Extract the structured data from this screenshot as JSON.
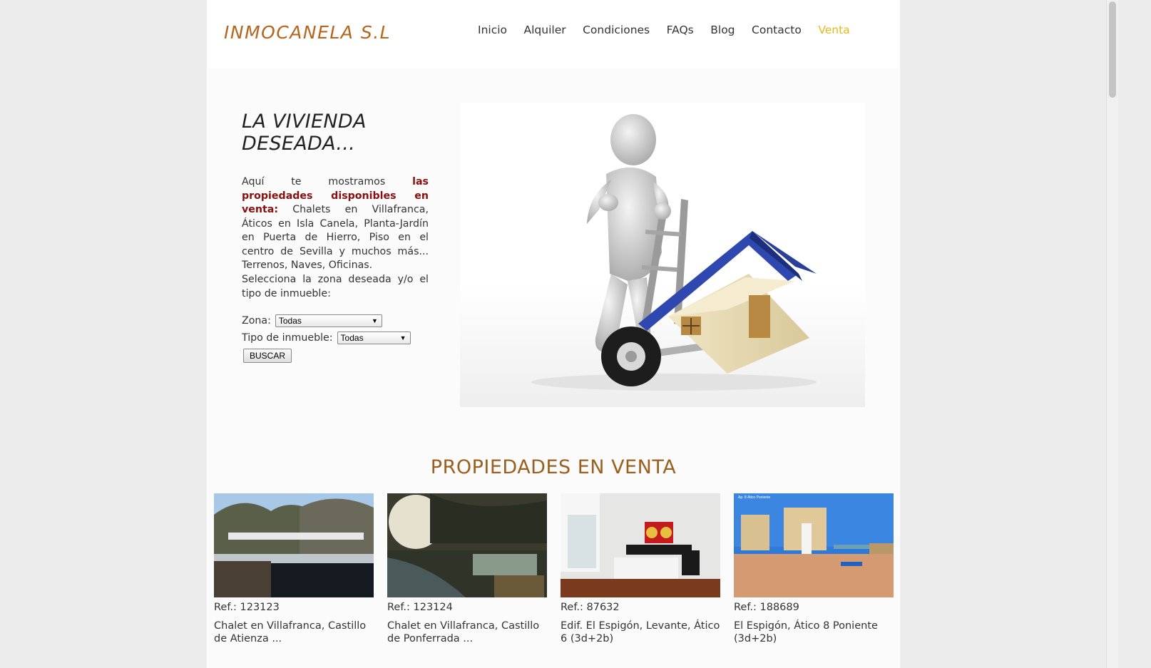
{
  "header": {
    "logo_text": "INMOCANELA S.L",
    "nav": [
      {
        "label": "Inicio",
        "active": false
      },
      {
        "label": "Alquiler",
        "active": false
      },
      {
        "label": "Condiciones",
        "active": false
      },
      {
        "label": "FAQs",
        "active": false
      },
      {
        "label": "Blog",
        "active": false
      },
      {
        "label": "Contacto",
        "active": false
      },
      {
        "label": "Venta",
        "active": true
      }
    ]
  },
  "hero": {
    "title_line1": "LA VIVIENDA",
    "title_line2": "DESEADA...",
    "intro_prefix": "Aquí te mostramos ",
    "intro_highlight": "las propiedades disponibles en venta:",
    "intro_rest": " Chalets en Villafranca, Áticos en Isla Canela, Planta-Jardín en Puerta de Hierro, Piso en el centro de Sevilla y muchos más... Terrenos, Naves, Oficinas.",
    "select_prompt": "Selecciona la zona deseada y/o el tipo de inmueble:",
    "zona_label": "Zona:",
    "zona_value": "Todas",
    "tipo_label": "Tipo de inmueble:",
    "tipo_value": "Todas",
    "search_button": "BUSCAR",
    "image_icon": "person-moving-house-illustration"
  },
  "listing": {
    "section_title": "PROPIEDADES EN VENTA",
    "properties": [
      {
        "ref": "Ref.: 123123",
        "title": "Chalet en Villafranca, Castillo de Atienza ..."
      },
      {
        "ref": "Ref.: 123124",
        "title": "Chalet en Villafranca, Castillo de Ponferrada ..."
      },
      {
        "ref": "Ref.: 87632",
        "title": "Edif. El Espigón, Levante, Ático 6 (3d+2b)"
      },
      {
        "ref": "Ref.: 188689",
        "title": "El Espigón, Ático 8 Poniente (3d+2b)",
        "photo_caption": "Ap. 8 Ático Poniente"
      }
    ]
  },
  "colors": {
    "nav_active": "#e8b818",
    "highlight": "#8a0f0f",
    "section_title": "#9b5f1e",
    "logo": "#b5651d"
  }
}
